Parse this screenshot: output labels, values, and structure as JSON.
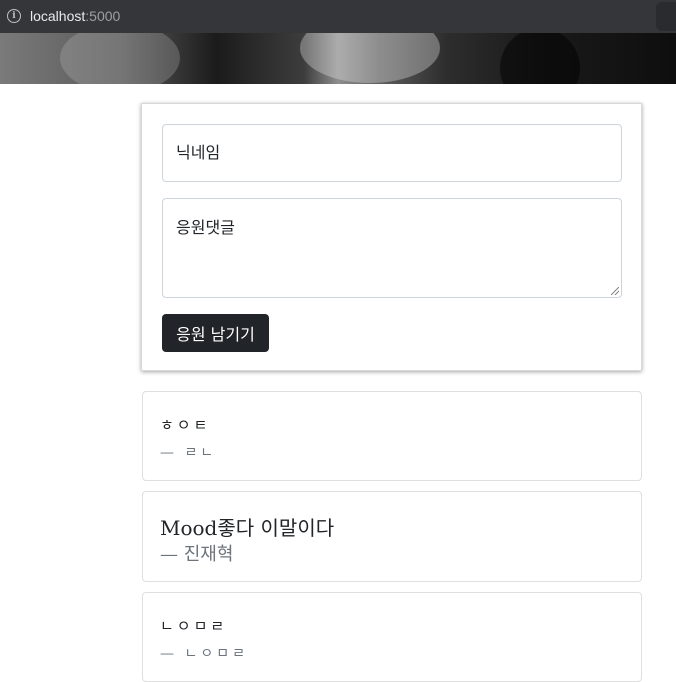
{
  "browser": {
    "url_host": "localhost",
    "url_port": ":5000"
  },
  "form": {
    "nickname_placeholder": "닉네임",
    "comment_placeholder": "응원댓글",
    "submit_label": "응원 남기기"
  },
  "comments": [
    {
      "text": "ㅎㅇㅌ",
      "author": "— ㄹㄴ"
    },
    {
      "text": "Mood좋다 이말이다",
      "author": "— 진재혁"
    },
    {
      "text": "ㄴㅇㅁㄹ",
      "author": "— ㄴㅇㅁㄹ"
    }
  ]
}
